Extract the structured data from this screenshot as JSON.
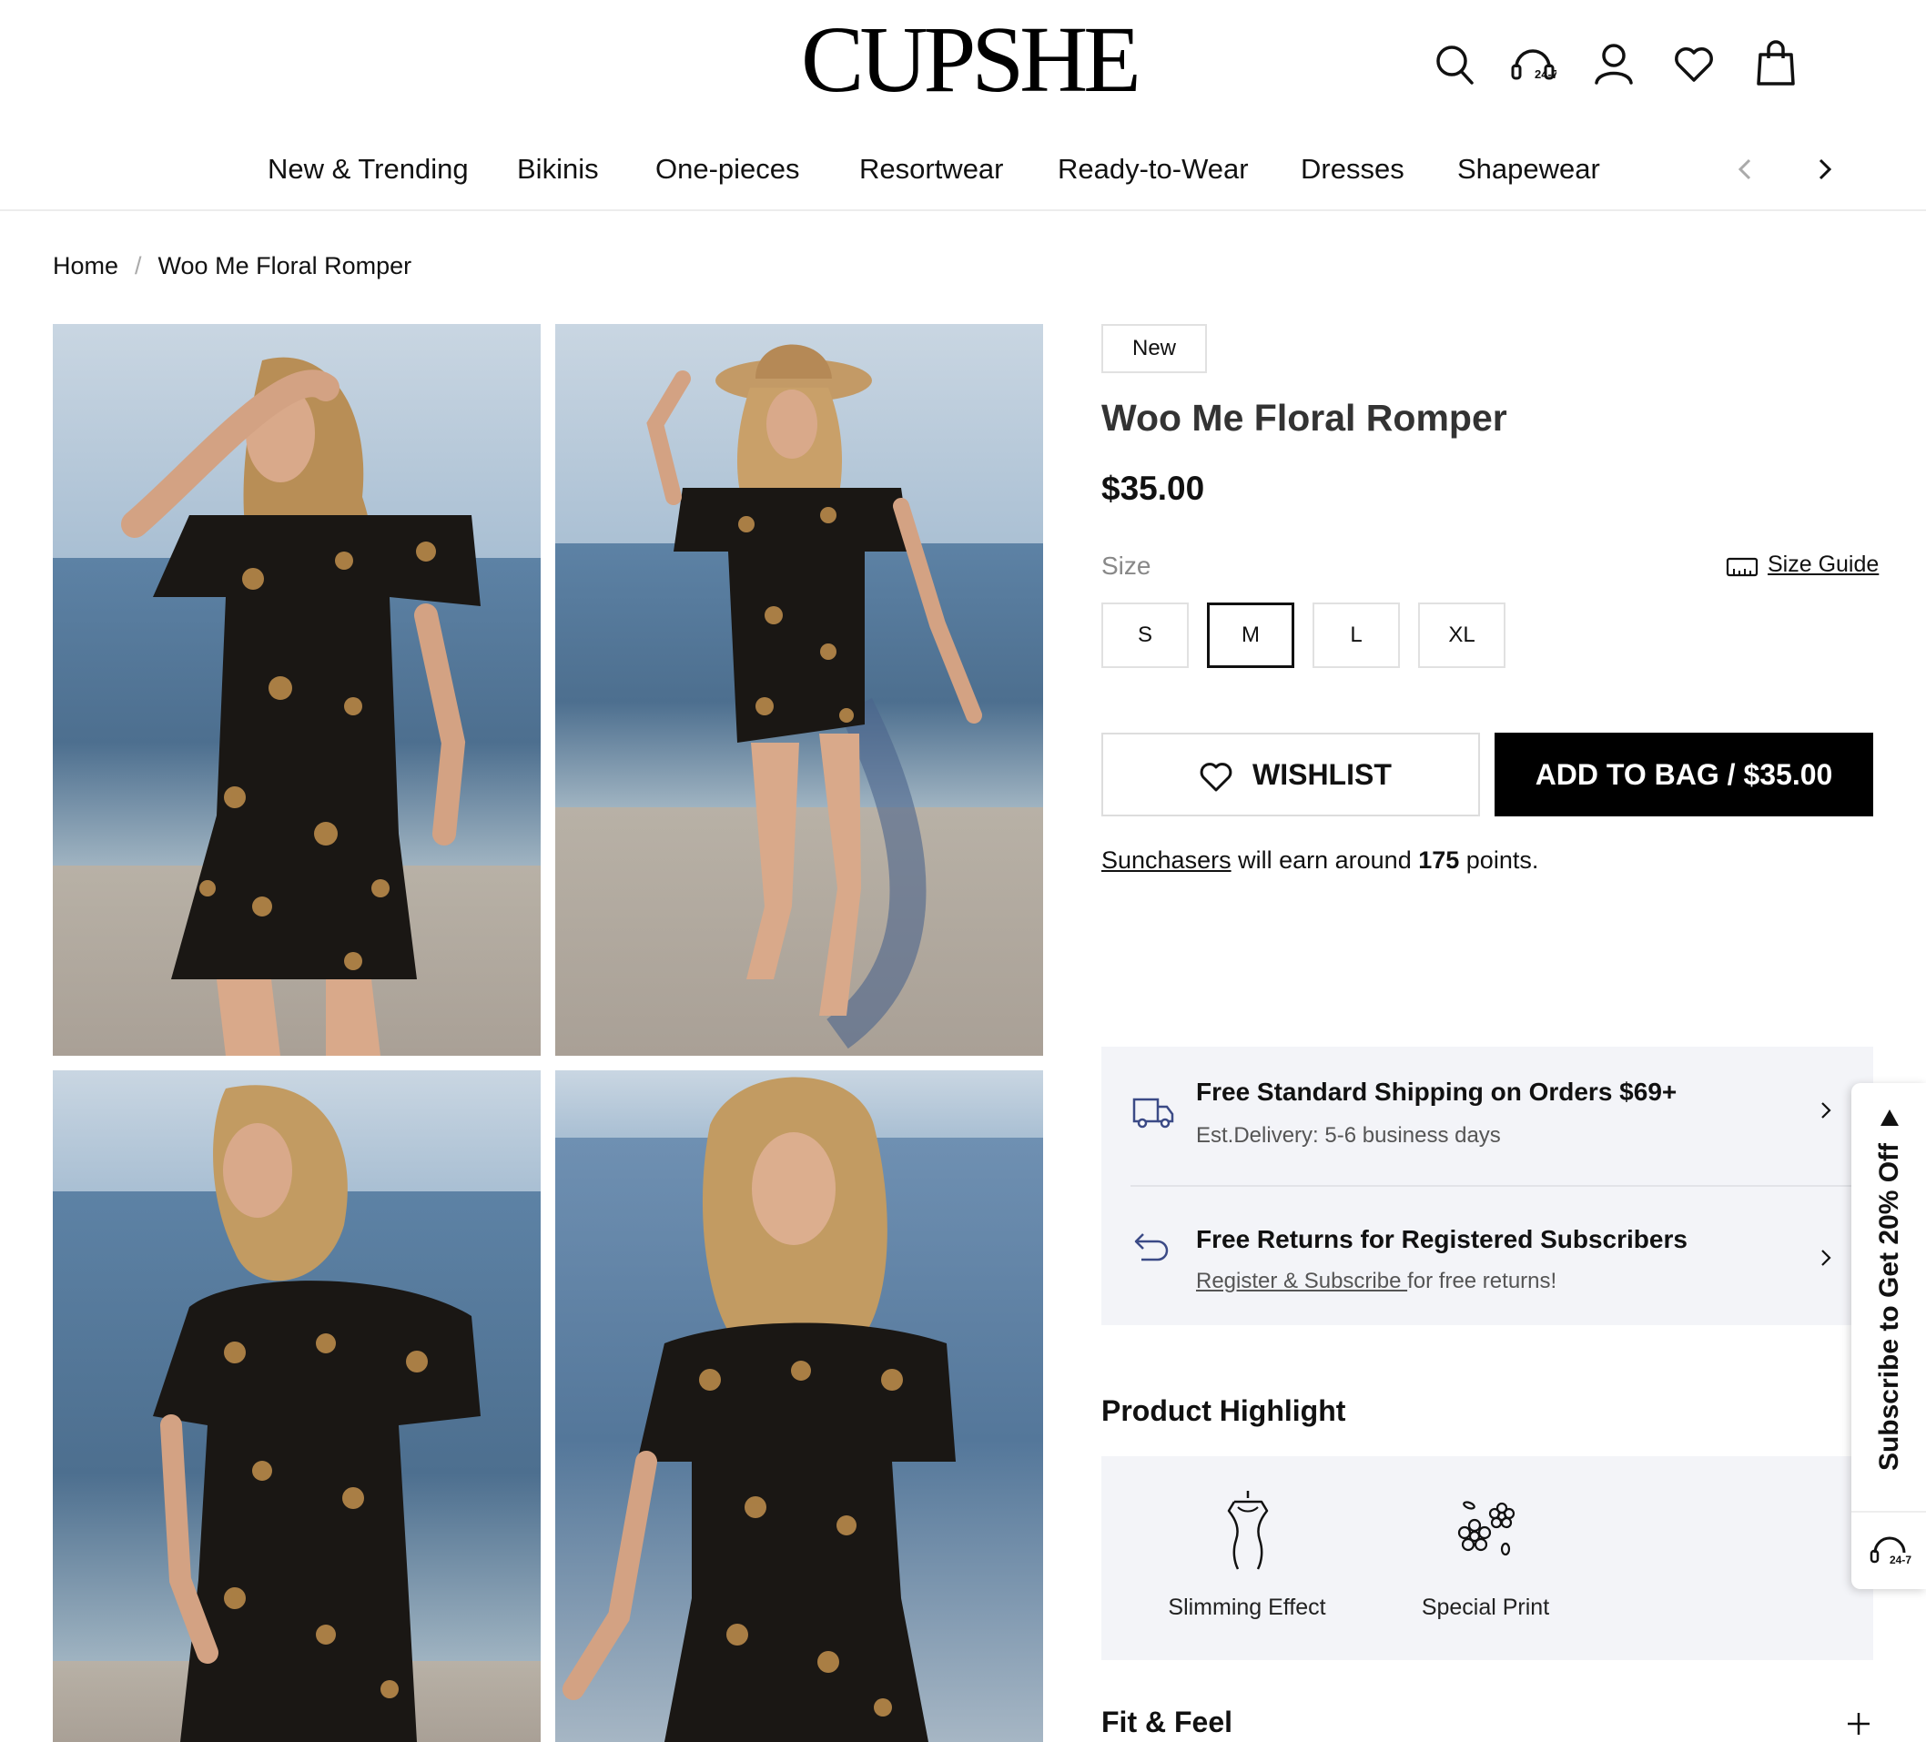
{
  "header": {
    "logo": "CUPSHE",
    "support_badge": "24-7",
    "nav": [
      "New & Trending",
      "Bikinis",
      "One-pieces",
      "Resortwear",
      "Ready-to-Wear",
      "Dresses",
      "Shapewear"
    ]
  },
  "breadcrumb": {
    "home": "Home",
    "separator": "/",
    "current": "Woo Me Floral Romper"
  },
  "product": {
    "badge": "New",
    "title": "Woo Me Floral Romper",
    "price": "$35.00",
    "size_label": "Size",
    "size_guide": "Size Guide",
    "sizes": [
      "S",
      "M",
      "L",
      "XL"
    ],
    "selected_size": "M",
    "wishlist": "WISHLIST",
    "add_to_bag": "ADD TO BAG / $35.00",
    "points": {
      "link": "Sunchasers",
      "text1": " will earn around ",
      "amount": "175",
      "text2": " points."
    }
  },
  "shipping": {
    "standard_title": "Free Standard Shipping on Orders $69+",
    "standard_sub": "Est.Delivery: 5-6 business days",
    "returns_title": "Free Returns for Registered Subscribers",
    "returns_link": "Register & Subscribe ",
    "returns_sub": "for free returns!"
  },
  "highlights": {
    "title": "Product Highlight",
    "items": [
      {
        "label": "Slimming Effect",
        "icon": "dress-form-icon"
      },
      {
        "label": "Special Print",
        "icon": "flower-print-icon"
      }
    ]
  },
  "fit_feel": "Fit & Feel",
  "side_tab": {
    "text": "Subscribe to Get 20% Off",
    "badge": "24-7"
  },
  "colors": {
    "accent": "#000000",
    "panel": "#f3f4f8",
    "icon_blue": "#3b4a86"
  }
}
